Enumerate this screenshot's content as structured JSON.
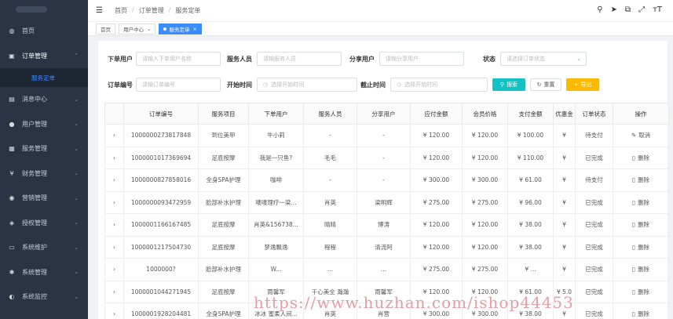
{
  "sidebar": {
    "items": [
      {
        "label": "首页",
        "icon": "dashboard-icon",
        "glyph": "◍"
      },
      {
        "label": "订单管理",
        "icon": "order-icon",
        "glyph": "▣",
        "open": true
      },
      {
        "label": "消息中心",
        "icon": "message-icon",
        "glyph": "▤"
      },
      {
        "label": "用户管理",
        "icon": "user-icon",
        "glyph": "●"
      },
      {
        "label": "服务管理",
        "icon": "service-icon",
        "glyph": "▦"
      },
      {
        "label": "财务管理",
        "icon": "finance-icon",
        "glyph": "¥"
      },
      {
        "label": "营销管理",
        "icon": "marketing-icon",
        "glyph": "◉"
      },
      {
        "label": "授权管理",
        "icon": "shield-icon",
        "glyph": "◈"
      },
      {
        "label": "系统维护",
        "icon": "monitor-icon",
        "glyph": "▭"
      },
      {
        "label": "系统管理",
        "icon": "gear-icon",
        "glyph": "✱"
      },
      {
        "label": "系统监控",
        "icon": "dashboard-icon",
        "glyph": "◐"
      }
    ],
    "subitem": "服务定单"
  },
  "header": {
    "breadcrumbs": [
      "首页",
      "订单管理",
      "服务定单"
    ],
    "tools": [
      "⚲",
      "➤",
      "⧉",
      "⤢",
      "ᴛT"
    ]
  },
  "tabs": [
    {
      "label": "首页"
    },
    {
      "label": "用户中心",
      "close": "⌄"
    },
    {
      "label": "服务定单",
      "close": "×",
      "active": true
    }
  ],
  "filters": {
    "row1": [
      {
        "label": "下单用户",
        "placeholder": "请输入下单用户名称"
      },
      {
        "label": "服务人员",
        "placeholder": "请输服务人员"
      },
      {
        "label": "分享用户",
        "placeholder": "请输分享用户"
      },
      {
        "label": "状态",
        "placeholder": "请选择订单状态"
      }
    ],
    "row2": [
      {
        "label": "订单编号",
        "placeholder": "请输订单编号"
      },
      {
        "label": "开始时间",
        "placeholder": "选择开始时间"
      },
      {
        "label": "截止时间",
        "placeholder": "选择开始时间"
      }
    ],
    "buttons": {
      "search": "搜索",
      "reset": "重置",
      "export": "导出"
    }
  },
  "table": {
    "columns": [
      "",
      "订单编号",
      "服务项目",
      "下单用户",
      "服务人员",
      "分享用户",
      "应付金额",
      "会员价格",
      "支付金额",
      "优惠金",
      "订单状态",
      "操作"
    ],
    "rows": [
      {
        "no": "1000000273817848",
        "item": "到位美甲",
        "user": "牛小莉",
        "staff": "-",
        "share": "-",
        "due": "¥ 120.00",
        "member": "¥ 120.00",
        "paid": "¥ 100.00",
        "discount": "¥",
        "status": "待支付",
        "status_type": "r",
        "action": "取消"
      },
      {
        "no": "1000001017369694",
        "item": "足底按摩",
        "user": "我是一只鱼?",
        "staff": "毛毛",
        "share": "-",
        "due": "¥ 120.00",
        "member": "¥ 120.00",
        "paid": "¥ 110.00",
        "discount": "¥",
        "status": "已完成",
        "status_type": "g",
        "action": "删除"
      },
      {
        "no": "1000000827858016",
        "item": "全身SPA护理",
        "user": "咖啡",
        "staff": "-",
        "share": "-",
        "due": "¥ 300.00",
        "member": "¥ 300.00",
        "paid": "¥ 61.00",
        "discount": "¥",
        "status": "待支付",
        "status_type": "r",
        "action": "删除"
      },
      {
        "no": "1000000093472959",
        "item": "脸部补水护理",
        "user": "唛唛理疗一梁...",
        "staff": "肖英",
        "share": "梁明辉",
        "due": "¥ 275.00",
        "member": "¥ 275.00",
        "paid": "¥ 96.00",
        "discount": "¥",
        "status": "已完成",
        "status_type": "g",
        "action": "删除"
      },
      {
        "no": "1000001166167485",
        "item": "足底按摩",
        "user": "肖英&156738...",
        "staff": "晴晴",
        "share": "博涛",
        "due": "¥ 120.00",
        "member": "¥ 120.00",
        "paid": "¥ 38.00",
        "discount": "¥",
        "status": "已完成",
        "status_type": "g",
        "action": "删除"
      },
      {
        "no": "1000001217504730",
        "item": "足底按摩",
        "user": "梦逸飘逸",
        "staff": "程程",
        "share": "清流阿",
        "due": "¥ 120.00",
        "member": "¥ 120.00",
        "paid": "¥ 38.00",
        "discount": "¥",
        "status": "已完成",
        "status_type": "g",
        "action": "删除"
      },
      {
        "no": "1000000?",
        "item": "脸部补水护理",
        "user": "W...",
        "staff": "...",
        "share": "...",
        "due": "¥ 275.00",
        "member": "¥ 275.00",
        "paid": "¥ ...",
        "discount": "¥",
        "status": "已完成",
        "status_type": "g",
        "action": "删除"
      },
      {
        "no": "1000001044271945",
        "item": "足底按摩",
        "user": "雨馨军",
        "staff": "千心美全 瀚瀚",
        "share": "雨馨军",
        "due": "¥ 120.00",
        "member": "¥ 120.00",
        "paid": "¥ 61.00",
        "discount": "¥ 5.0",
        "status": "已完成",
        "status_type": "g",
        "action": "删除"
      },
      {
        "no": "1000001928204481",
        "item": "全身SPA护理",
        "user": "冰冰 蜜柔人间...",
        "staff": "肖英",
        "share": "肖营",
        "due": "¥ 300.00",
        "member": "¥ 300.00",
        "paid": "¥ 38.00",
        "discount": "¥",
        "status": "已完成",
        "status_type": "g",
        "action": "删除"
      }
    ]
  },
  "watermark": "https://www.huzhan.com/ishop44453",
  "colors": {
    "sidebar_bg": "#2b3445",
    "accent": "#3b8cff",
    "search": "#13c2c2",
    "export": "#ffb800",
    "red": "#e53935",
    "green": "#2e9e2e"
  }
}
